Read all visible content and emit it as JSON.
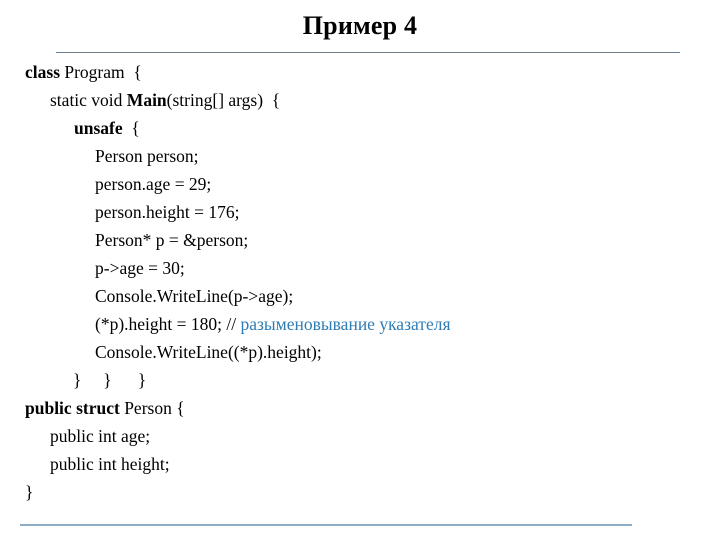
{
  "slide": {
    "title": "Пример 4",
    "background_color": "#ffffff",
    "rule_top_color": "#6d7f8f",
    "rule_bottom_color": "#8fadc4",
    "comment_color": "#2f7cb5",
    "text_color": "#000000"
  },
  "code": {
    "language": "csharp",
    "lines": [
      {
        "id": "line-1",
        "indent": 0,
        "segments": [
          {
            "text": "class ",
            "bold": true
          },
          {
            "text": "Program  {",
            "bold": false
          }
        ]
      },
      {
        "id": "line-2",
        "indent": 1,
        "segments": [
          {
            "text": "static void ",
            "bold": false
          },
          {
            "text": "Main",
            "bold": true
          },
          {
            "text": "(string[] args)  {",
            "bold": false
          }
        ]
      },
      {
        "id": "line-3",
        "indent": 2,
        "segments": [
          {
            "text": "unsafe",
            "bold": true
          },
          {
            "text": "  {",
            "bold": false
          }
        ]
      },
      {
        "id": "line-4",
        "indent": 3,
        "segments": [
          {
            "text": "Person person;",
            "bold": false
          }
        ]
      },
      {
        "id": "line-5",
        "indent": 3,
        "segments": [
          {
            "text": "person.age = 29;",
            "bold": false
          }
        ]
      },
      {
        "id": "line-6",
        "indent": 3,
        "segments": [
          {
            "text": "person.height = 176;",
            "bold": false
          }
        ]
      },
      {
        "id": "line-7",
        "indent": 3,
        "segments": [
          {
            "text": "Person* p = &person;",
            "bold": false
          }
        ]
      },
      {
        "id": "line-8",
        "indent": 3,
        "segments": [
          {
            "text": "p->age = 30;",
            "bold": false
          }
        ]
      },
      {
        "id": "line-9",
        "indent": 3,
        "segments": [
          {
            "text": "Console.WriteLine(p->age);",
            "bold": false
          }
        ]
      },
      {
        "id": "line-10",
        "indent": 3,
        "segments": [
          {
            "text": "(*p).height = 180; // ",
            "bold": false
          },
          {
            "text": "разыменовывание указателя",
            "bold": false,
            "comment": true
          }
        ]
      },
      {
        "id": "line-11",
        "indent": 3,
        "segments": [
          {
            "text": "Console.WriteLine((*p).height);",
            "bold": false
          }
        ]
      },
      {
        "id": "line-12",
        "indent": 4,
        "segments": [
          {
            "text": "}     }      }",
            "bold": false
          }
        ]
      },
      {
        "id": "line-13",
        "indent": 0,
        "segments": [
          {
            "text": "public struct ",
            "bold": true
          },
          {
            "text": "Person {",
            "bold": false
          }
        ]
      },
      {
        "id": "line-14",
        "indent": 1,
        "segments": [
          {
            "text": "public int age;",
            "bold": false
          }
        ]
      },
      {
        "id": "line-15",
        "indent": 1,
        "segments": [
          {
            "text": "public int height;",
            "bold": false
          }
        ]
      },
      {
        "id": "line-16",
        "indent": 0,
        "segments": [
          {
            "text": "}",
            "bold": false
          }
        ]
      }
    ]
  }
}
